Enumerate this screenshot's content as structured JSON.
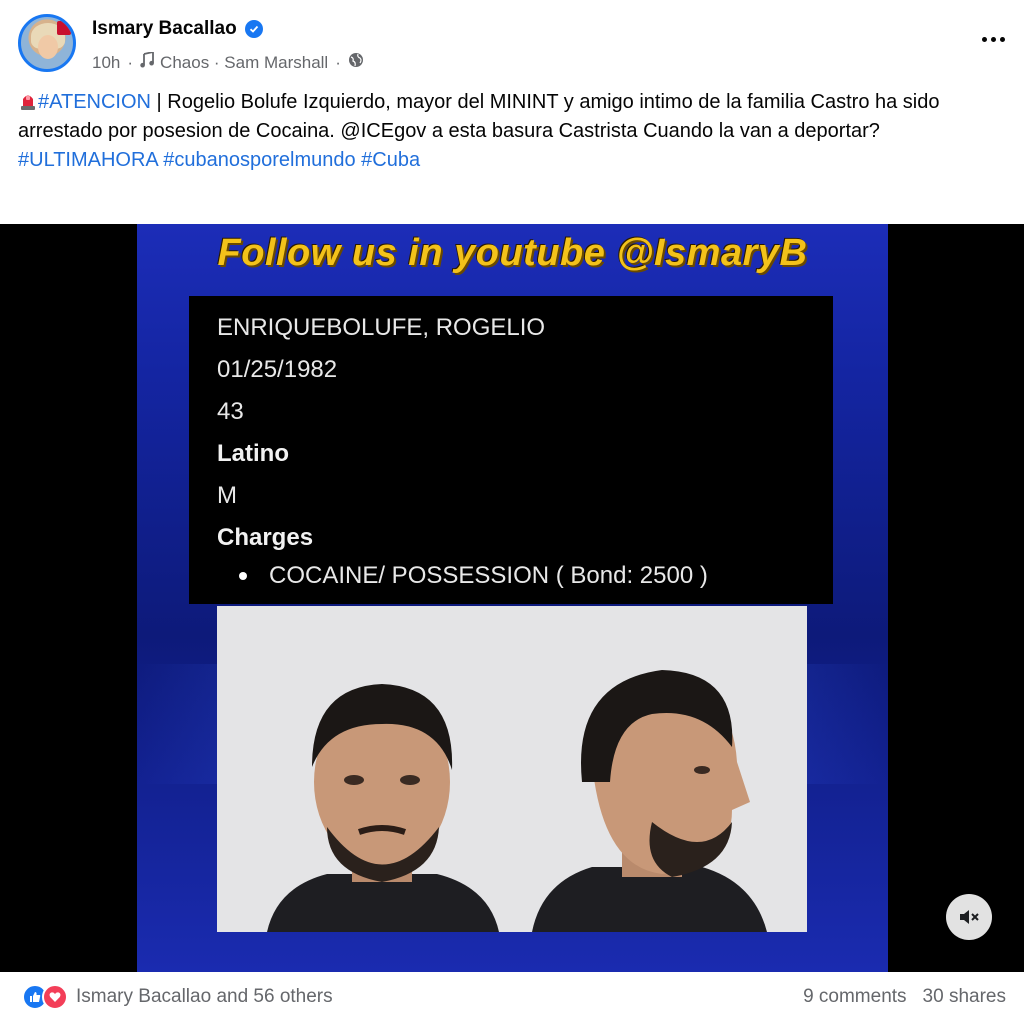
{
  "post": {
    "author": "Ismary Bacallao",
    "time": "10h",
    "music": "Chaos · Sam Marshall",
    "audience_icon": "globe-icon"
  },
  "text": {
    "hashtag_1": "#ATENCION",
    "body_part1": " | Rogelio Bolufe Izquierdo, mayor del MININT y amigo intimo de la familia Castro ha sido arrestado por posesion de Cocaina. ",
    "mention": "@ICEgov",
    "body_part2": " a esta basura Castrista Cuando la van a deportar?",
    "hashtag_2": "#ULTIMAHORA",
    "hashtag_3": "#cubanosporelmundo",
    "hashtag_4": "#Cuba"
  },
  "video": {
    "banner": "Follow us in youtube @IsmaryB",
    "name": "ENRIQUEBOLUFE, ROGELIO",
    "dob": "01/25/1982",
    "age": "43",
    "race": "Latino",
    "sex": "M",
    "charges_label": "Charges",
    "charge_1": "COCAINE/ POSSESSION ( Bond: 2500 )"
  },
  "footer": {
    "reactions_text": "Ismary Bacallao and 56 others",
    "comments": "9 comments",
    "shares": "30 shares"
  },
  "colors": {
    "link": "#216fdb",
    "verified": "#1877f2",
    "banner_text": "#f3c21a"
  }
}
